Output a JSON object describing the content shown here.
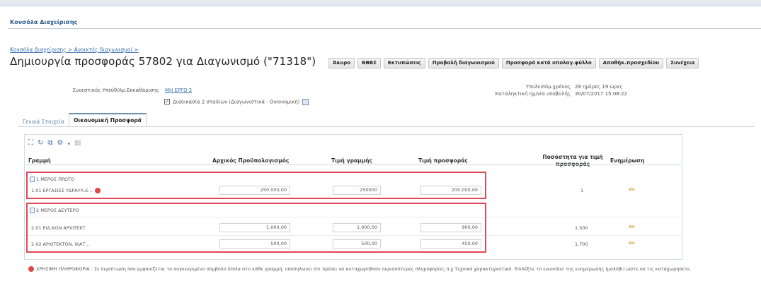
{
  "panel": {
    "title": "Κονσόλα Διαχείρισης"
  },
  "breadcrumb": "Κονσόλα Διαχείρισης > Ανοικτές διαγωνισμοί >",
  "page_title": "Δημιουργία προσφοράς 57802 για Διαγωνισμό (\"71318\")",
  "toolbar": {
    "buttons": [
      "Άκυρο",
      "ΒΒΒΣ",
      "Εκτυπώσεις",
      "Προβολή διαγωνισμού",
      "Προσφορά κατά υπολογ.φύλλο",
      "Αποθήκ.προσχεδίου",
      "Συνέχεια"
    ]
  },
  "info": {
    "contact_label": "Συνεστικός Υπεύθ/Αρ.Εκκαθάρισης",
    "contact_value": "ΜΗ ΕΡΓΟ 2",
    "checkbox_label": "Διαδικασία 2 σταδίων (Διαγωνιστικά - Οικονομική)",
    "remaining_label": "Υπολειπόμ.χρόνος",
    "remaining_value": "28 ημέρες 19 ώρες",
    "deadline_label": "Καταληκτική ημ/νία υποβολής",
    "deadline_value": "30/07/2017 15:08:22"
  },
  "tabs": [
    "Γενικά Στοιχεία",
    "Οικονομική Προσφορά"
  ],
  "table": {
    "headers": {
      "line": "Γραμμή",
      "initial_budget": "Αρχικός Προϋπολογισμός",
      "line_price": "Τιμή γραμμής",
      "offer_price": "Τιμή προσφοράς",
      "percent": "Ποσόστητα για τιμή προσφοράς",
      "update": "Ενημέρωση"
    },
    "group1": {
      "label": "1 ΜΕΡΟΣ ΠΡΩΤΟ",
      "row": {
        "name": "1.01 ΕΡΓΑΣΙΕΣ ΥΔΡΑΥΛ.Ε...",
        "budget": "250.000,00",
        "line_price": "250000",
        "offer": "200.000,00",
        "qty": "1"
      }
    },
    "group2": {
      "label": "2 ΜΕΡΟΣ ΔΕΥΤΕΡΟ",
      "rows": [
        {
          "name": "2.01 ΕΙΔ.ΚΟΝ ΑΡΧΙΤΕΚΤ.",
          "budget": "1.000,00",
          "line_price": "1.000,00",
          "offer": "900,00",
          "qty": "1.500"
        },
        {
          "name": "2.02 ΑΡΧΙΤΕΚΤΟΝ. ΙΚΑΤ...",
          "budget": "500,00",
          "line_price": "500,00",
          "offer": "450,00",
          "qty": "1.700"
        }
      ]
    }
  },
  "note": "ΧΡΗΣΙΜΗ ΠΛΗΡΟΦΟΡΙΑ : Σε περίπτωση που εμφανίζεται το συγκεκριμένο σύμβολο δίπλα στο κάθε γραμμή, υποδηλώνει ότι πρέπει να καταχωρηθούν περισσότερες πληροφορίες π.χ Τεχνικά χαρακτηριστικά. Επιλέξτε το εικονίδιο της ενημέρωσης (μολύβι) ώστε να τις καταχωρήσετε."
}
